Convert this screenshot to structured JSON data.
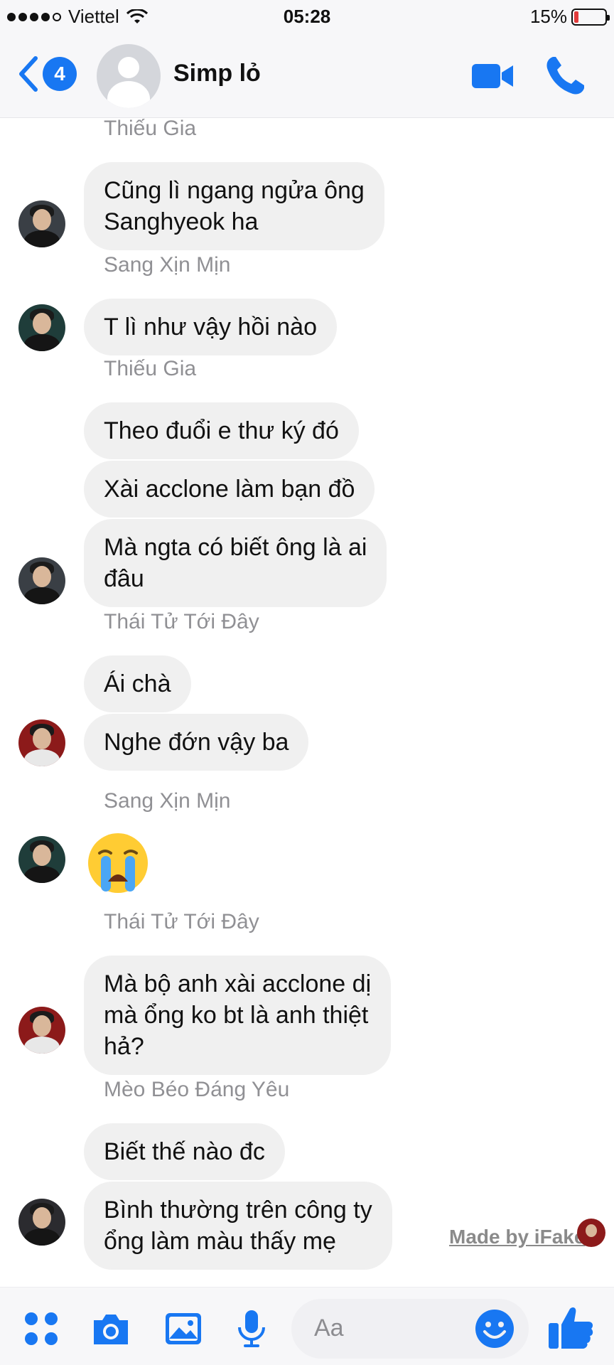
{
  "status": {
    "carrier": "Viettel",
    "time": "05:28",
    "battery_percent": "15%",
    "battery_level": 0.15
  },
  "header": {
    "unread_count": "4",
    "title": "Simp lỏ"
  },
  "messages": [
    {
      "sender": "Thiếu Gia",
      "bubbles": [
        [
          "Cũng lì ngang ngửa ông",
          "Sanghyeok ha"
        ]
      ]
    },
    {
      "sender": "Sang Xịn Mịn",
      "bubbles": [
        [
          "T lì như vậy hồi nào"
        ]
      ]
    },
    {
      "sender": "Thiếu Gia",
      "bubbles": [
        [
          "Theo đuổi e thư ký đó"
        ],
        [
          "Xài acclone làm bạn đồ"
        ],
        [
          "Mà ngta có biết ông là ai",
          "đâu"
        ]
      ]
    },
    {
      "sender": "Thái Tử Tới Đây",
      "bubbles": [
        [
          "Ái chà"
        ],
        [
          "Nghe đớn vậy ba"
        ]
      ]
    },
    {
      "sender": "Sang Xịn Mịn",
      "bubbles": [],
      "emoji": "crying-face"
    },
    {
      "sender": "Thái Tử Tới Đây",
      "bubbles": [
        [
          "Mà bộ anh xài acclone dị",
          "mà ổng ko bt là anh thiệt",
          "hả?"
        ]
      ]
    },
    {
      "sender": "Mèo Béo Đáng Yêu",
      "bubbles": [
        [
          "Biết thế nào đc"
        ],
        [
          "Bình thường trên công ty",
          "ổng làm màu thấy mẹ"
        ]
      ]
    }
  ],
  "watermark": "Made by iFake",
  "composer": {
    "placeholder": "Aa"
  },
  "colors": {
    "accent": "#1877f2",
    "bubble": "#f0f0f0",
    "sender_name": "#909094"
  }
}
